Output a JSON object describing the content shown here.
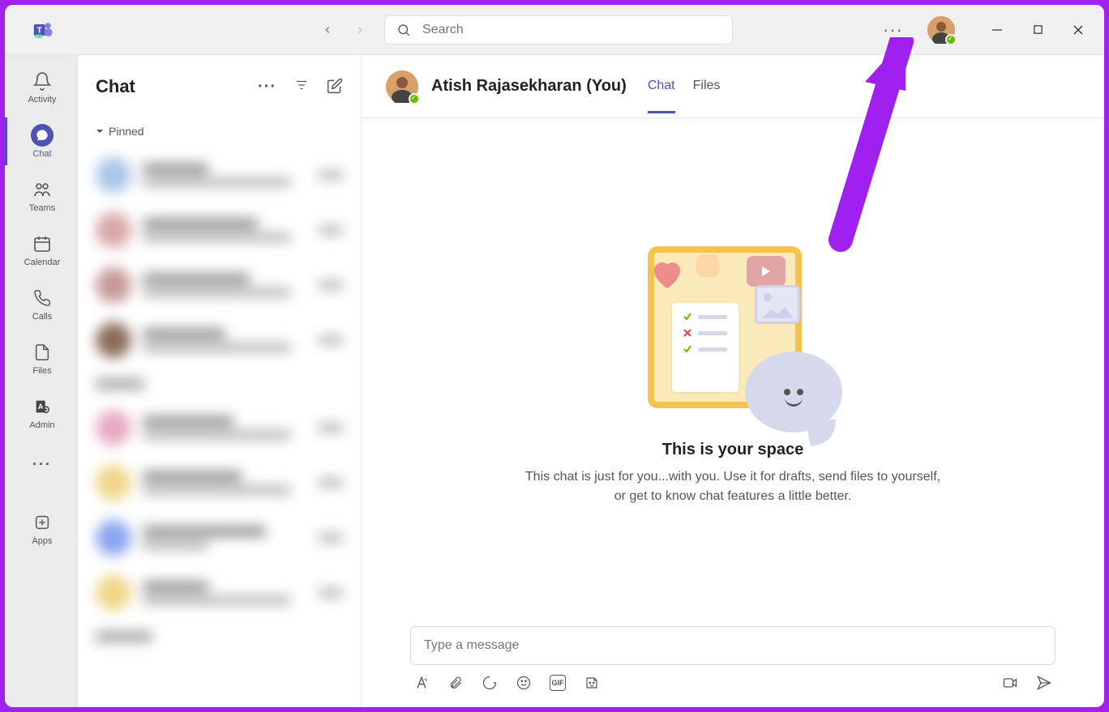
{
  "search": {
    "placeholder": "Search"
  },
  "rail": {
    "items": [
      {
        "label": "Activity",
        "icon": "bell-icon"
      },
      {
        "label": "Chat",
        "icon": "chat-icon",
        "active": true
      },
      {
        "label": "Teams",
        "icon": "teams-icon"
      },
      {
        "label": "Calendar",
        "icon": "calendar-icon"
      },
      {
        "label": "Calls",
        "icon": "calls-icon"
      },
      {
        "label": "Files",
        "icon": "files-icon"
      },
      {
        "label": "Admin",
        "icon": "admin-icon"
      }
    ],
    "more_label": "",
    "apps_label": "Apps"
  },
  "chat_list": {
    "title": "Chat",
    "section_pinned": "Pinned"
  },
  "chat_main": {
    "person_name": "Atish Rajasekharan (You)",
    "tabs": [
      {
        "label": "Chat",
        "active": true
      },
      {
        "label": "Files",
        "active": false
      }
    ],
    "empty_title": "This is your space",
    "empty_text": "This chat is just for you...with you. Use it for drafts, send files to yourself, or get to know chat features a little better.",
    "composer_placeholder": "Type a message",
    "gif_label": "GIF"
  },
  "colors": {
    "accent": "#4f52b2",
    "presence_available": "#6bb700",
    "annotation": "#a020f0"
  }
}
